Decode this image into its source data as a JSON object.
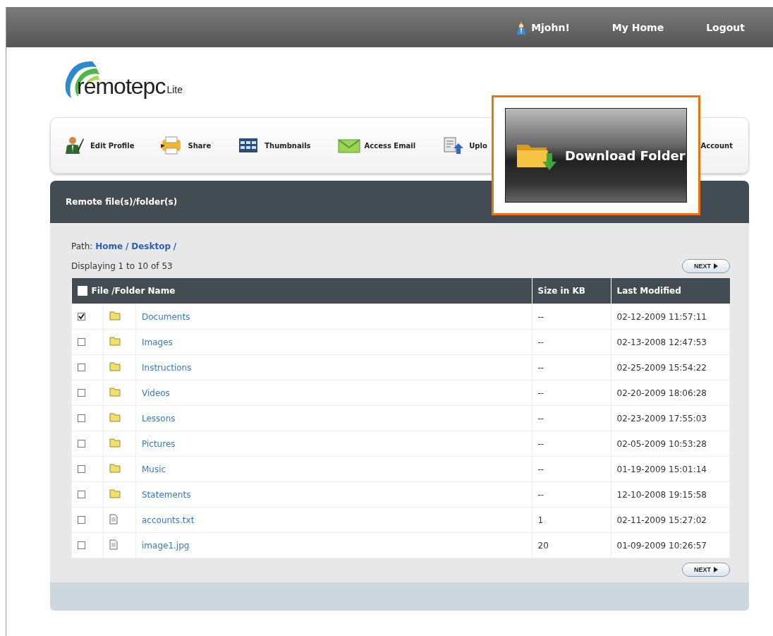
{
  "top_bar": {
    "user": "Mjohn!",
    "links": [
      "My Home",
      "Logout"
    ]
  },
  "logo": {
    "name": "remotepc",
    "suffix": "Lite"
  },
  "toolbar": [
    {
      "kind": "profile",
      "label": "Edit Profile"
    },
    {
      "kind": "share",
      "label": "Share"
    },
    {
      "kind": "grid",
      "label": "Thumbnails"
    },
    {
      "kind": "email",
      "label": "Access Email"
    },
    {
      "kind": "upload",
      "label": "Uplo"
    },
    {
      "kind": "plain",
      "label": "Account"
    }
  ],
  "callout": {
    "label": "Download Folder"
  },
  "panel": {
    "title": "Remote file(s)/folder(s)",
    "path_label": "Path:",
    "path": [
      "Home",
      "Desktop"
    ],
    "path_sep": "/",
    "count": "Displaying 1 to 10 of 53",
    "next": "NEXT",
    "columns": [
      {
        "label": "File /Folder Name",
        "checked": false
      },
      {
        "label": "Size in KB"
      },
      {
        "label": "Last Modified"
      }
    ],
    "rows": [
      {
        "kind": "folder",
        "checked": true,
        "name": "Documents",
        "size": "--",
        "modified": "02-12-2009 11:57:11"
      },
      {
        "kind": "folder",
        "checked": false,
        "name": "Images",
        "size": "--",
        "modified": "02-13-2008 12:47:53"
      },
      {
        "kind": "folder",
        "checked": false,
        "name": "Instructions",
        "size": "--",
        "modified": "02-25-2009 15:54:22"
      },
      {
        "kind": "folder",
        "checked": false,
        "name": "Videos",
        "size": "--",
        "modified": "02-20-2009 18:06:28"
      },
      {
        "kind": "folder",
        "checked": false,
        "name": "Lessons",
        "size": "--",
        "modified": "02-23-2009 17:55:03"
      },
      {
        "kind": "folder",
        "checked": false,
        "name": "Pictures",
        "size": "--",
        "modified": "02-05-2009 10:53:28"
      },
      {
        "kind": "folder",
        "checked": false,
        "name": "Music",
        "size": "--",
        "modified": "01-19-2009 15:01:14"
      },
      {
        "kind": "folder",
        "checked": false,
        "name": "Statements",
        "size": "--",
        "modified": "12-10-2008 19:15:58"
      },
      {
        "kind": "file",
        "checked": false,
        "name": "accounts.txt",
        "size": "1",
        "modified": "02-11-2009 15:27:02"
      },
      {
        "kind": "file",
        "checked": false,
        "name": "image1.jpg",
        "size": "20",
        "modified": "01-09-2009 10:26:57"
      }
    ],
    "next_bottom": "NEXT"
  }
}
